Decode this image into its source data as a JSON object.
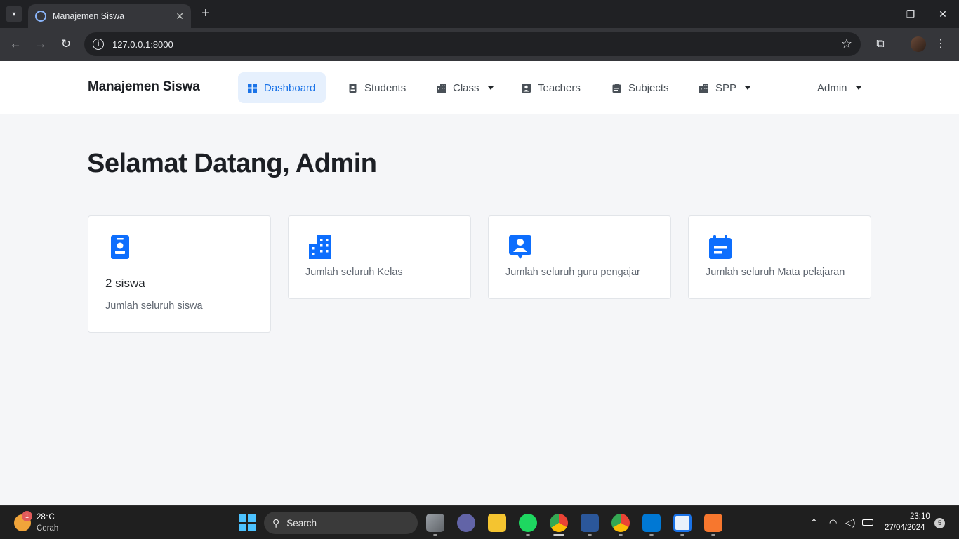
{
  "browser": {
    "tab_title": "Manajemen Siswa",
    "new_tab_symbol": "+",
    "url": "127.0.0.1:8000"
  },
  "navbar": {
    "brand": "Manajemen Siswa",
    "items": [
      {
        "label": "Dashboard",
        "icon": "grid-icon",
        "active": true
      },
      {
        "label": "Students",
        "icon": "id-badge-icon"
      },
      {
        "label": "Class",
        "icon": "building-icon",
        "dropdown": true
      },
      {
        "label": "Teachers",
        "icon": "user-square-icon"
      },
      {
        "label": "Subjects",
        "icon": "clipboard-icon"
      },
      {
        "label": "SPP",
        "icon": "building-icon",
        "dropdown": true
      }
    ],
    "user": "Admin",
    "accent_color": "#1a73e8",
    "active_bg": "#e6f0fd"
  },
  "page": {
    "greeting": "Selamat Datang, Admin"
  },
  "cards": [
    {
      "icon": "id-badge-icon",
      "count": "2 siswa",
      "description": "Jumlah seluruh siswa"
    },
    {
      "icon": "building-icon",
      "count": "",
      "description": "Jumlah seluruh Kelas"
    },
    {
      "icon": "teacher-board-icon",
      "count": "",
      "description": "Jumlah seluruh guru pengajar"
    },
    {
      "icon": "calendar-icon",
      "count": "",
      "description": "Jumlah seluruh Mata pelajaran"
    }
  ],
  "taskbar": {
    "weather_badge": "1",
    "temperature": "28°C",
    "weather": "Cerah",
    "search_placeholder": "Search",
    "time": "23:10",
    "date": "27/04/2024",
    "notifications": "5"
  }
}
